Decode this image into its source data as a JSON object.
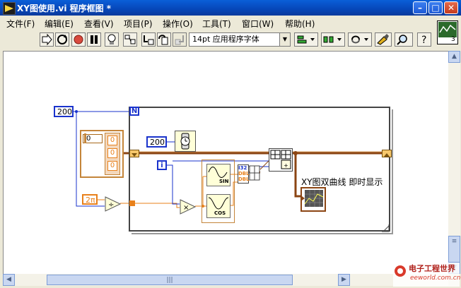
{
  "window": {
    "title": "XY图使用.vi 程序框图 *",
    "controls": {
      "minimize": "–",
      "maximize": "□",
      "close": "✕"
    }
  },
  "menu": [
    "文件(F)",
    "编辑(E)",
    "查看(V)",
    "项目(P)",
    "操作(O)",
    "工具(T)",
    "窗口(W)",
    "帮助(H)"
  ],
  "toolbar": {
    "font": "14pt 应用程序字体",
    "icons": [
      "run-arrow-icon",
      "run-continuously-icon",
      "abort-icon",
      "pause-icon",
      "highlight-execution-icon",
      "retain-wire-values-icon",
      "step-into-icon",
      "step-over-icon",
      "step-out-icon",
      "align-icon",
      "distribute-icon",
      "reorder-icon",
      "clean-diagram-icon",
      "search-icon",
      "help-icon"
    ]
  },
  "connector_pane_number": "3",
  "diagram": {
    "count_constant": "200",
    "loop_count_terminal": "N",
    "loop_index_terminal": "i",
    "wait_constant": "200",
    "two_pi_constant": "2π",
    "array_index_value": "0",
    "array_values": [
      "0",
      "0",
      "0"
    ],
    "sin_label": "SIN",
    "cos_label": "COS",
    "dbl_label_1": "DBL",
    "dbl_label_2": "DBL",
    "unbundle_label": "I32",
    "graph_label": "XY图双曲线 即时显示"
  },
  "watermark": {
    "cn": "电子工程世界",
    "en": "eeworld.com.cn"
  },
  "colors": {
    "title_bar": "#0a4fc8",
    "wire_blue": "#1a33cc",
    "wire_orange": "#e8801a",
    "cluster_wire": "#8b4513"
  }
}
